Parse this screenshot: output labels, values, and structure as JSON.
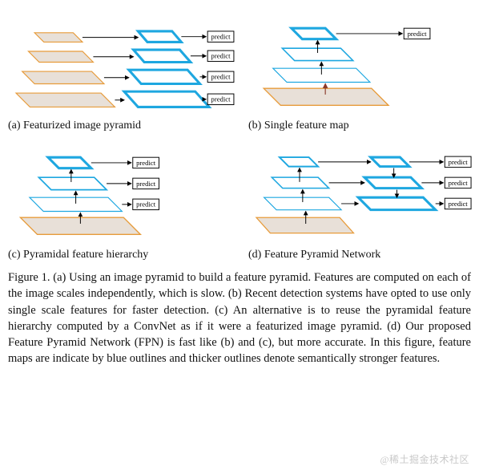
{
  "panels": {
    "a": {
      "subcaption": "(a) Featurized image pyramid"
    },
    "b": {
      "subcaption": "(b) Single feature map"
    },
    "c": {
      "subcaption": "(c) Pyramidal feature hierarchy"
    },
    "d": {
      "subcaption": "(d) Feature Pyramid Network"
    }
  },
  "labels": {
    "predict": "predict"
  },
  "caption": "Figure 1. (a) Using an image pyramid to build a feature pyramid. Features are computed on each of the image scales independently, which is slow. (b) Recent detection systems have opted to use only single scale features for faster detection. (c) An alternative is to reuse the pyramidal feature hierarchy computed by a ConvNet as if it were a featurized image pyramid. (d) Our proposed Feature Pyramid Network (FPN) is fast like (b) and (c), but more accurate. In this figure, feature maps are indicate by blue outlines and thicker outlines denote semantically stronger features.",
  "watermark": "@稀土掘金技术社区"
}
